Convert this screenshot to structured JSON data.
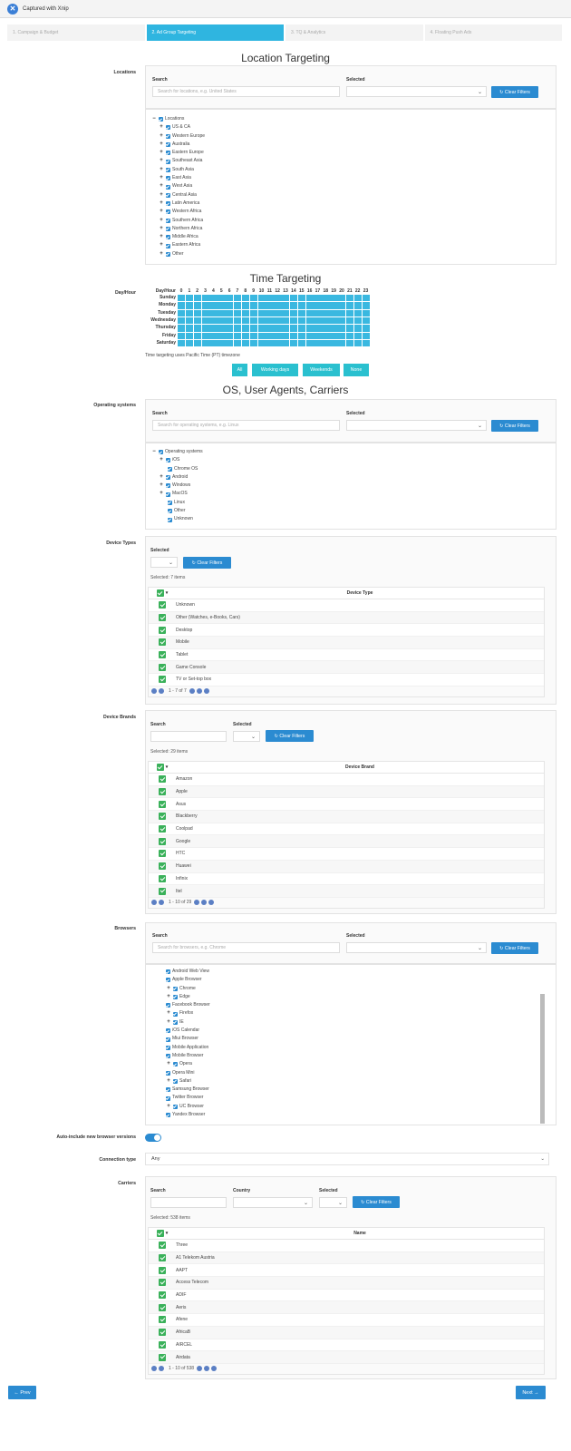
{
  "topbar": {
    "capture_label": "Captured with Xnip"
  },
  "steps": [
    "1. Campaign & Budget",
    "2. Ad Group Targeting",
    "3. TQ & Analytics",
    "4. Floating Push Ads"
  ],
  "location": {
    "heading": "Location Targeting",
    "label": "Locations",
    "search_label": "Search",
    "search_placeholder": "Search for locations, e.g. United States",
    "selected_label": "Selected",
    "clear_label": "Clear Filters",
    "root": "Locations",
    "items": [
      "US & CA",
      "Western Europe",
      "Australia",
      "Eastern Europe",
      "Southeast Asia",
      "South Asia",
      "East Asia",
      "West Asia",
      "Central Asia",
      "Latin America",
      "Western Africa",
      "Southern Africa",
      "Northern Africa",
      "Middle Africa",
      "Eastern Africa",
      "Other"
    ]
  },
  "time": {
    "heading": "Time Targeting",
    "label": "Day/Hour",
    "corner": "Day/Hour",
    "days": [
      "Sunday",
      "Monday",
      "Tuesday",
      "Wednesday",
      "Thursday",
      "Friday",
      "Saturday"
    ],
    "hours": [
      "0",
      "1",
      "2",
      "3",
      "4",
      "5",
      "6",
      "7",
      "8",
      "9",
      "10",
      "11",
      "12",
      "13",
      "14",
      "15",
      "16",
      "17",
      "18",
      "19",
      "20",
      "21",
      "22",
      "23"
    ],
    "note": "Time targeting uses Pacific Time (PT) timezone",
    "buttons": [
      "All",
      "Working days",
      "Weekends",
      "None"
    ]
  },
  "os": {
    "heading": "OS, User Agents, Carriers",
    "label": "Operating systems",
    "search_label": "Search",
    "search_placeholder": "Search for operating systems, e.g. Linux",
    "selected_label": "Selected",
    "clear_label": "Clear Filters",
    "root": "Operating systems",
    "items": [
      {
        "t": "iOS",
        "p": true
      },
      {
        "t": "Chrome OS",
        "p": false
      },
      {
        "t": "Android",
        "p": true
      },
      {
        "t": "Windows",
        "p": true
      },
      {
        "t": "MacOS",
        "p": true
      },
      {
        "t": "Linux",
        "p": false
      },
      {
        "t": "Other",
        "p": false
      },
      {
        "t": "Unknown",
        "p": false
      }
    ]
  },
  "device_types": {
    "label": "Device Types",
    "selected_label": "Selected",
    "clear_label": "Clear Filters",
    "count": "Selected: 7 items",
    "column": "Device Type",
    "rows": [
      "Unknown",
      "Other (Watches, e-Books, Cars)",
      "Desktop",
      "Mobile",
      "Tablet",
      "Game Console",
      "TV or Set-top box"
    ],
    "pager": "1 - 7 of 7"
  },
  "device_brands": {
    "label": "Device Brands",
    "search_label": "Search",
    "selected_label": "Selected",
    "clear_label": "Clear Filters",
    "count": "Selected: 29 items",
    "column": "Device Brand",
    "rows": [
      "Amazon",
      "Apple",
      "Asus",
      "Blackberry",
      "Coolpad",
      "Google",
      "HTC",
      "Huawei",
      "Infinix",
      "Itel"
    ],
    "pager": "1 - 10 of 29"
  },
  "browsers": {
    "label": "Browsers",
    "search_label": "Search",
    "search_placeholder": "Search for browsers, e.g. Chrome",
    "selected_label": "Selected",
    "clear_label": "Clear Filters",
    "items": [
      {
        "t": "Android Web View",
        "p": false
      },
      {
        "t": "Apple Browser",
        "p": false
      },
      {
        "t": "Chrome",
        "p": true
      },
      {
        "t": "Edge",
        "p": true
      },
      {
        "t": "Facebook Browser",
        "p": false
      },
      {
        "t": "Firefox",
        "p": true
      },
      {
        "t": "IE",
        "p": true
      },
      {
        "t": "iOS Calendar",
        "p": false
      },
      {
        "t": "Miui Browser",
        "p": false
      },
      {
        "t": "Mobile Application",
        "p": false
      },
      {
        "t": "Mobile Browser",
        "p": false
      },
      {
        "t": "Opera",
        "p": true
      },
      {
        "t": "Opera Mini",
        "p": false
      },
      {
        "t": "Safari",
        "p": true
      },
      {
        "t": "Samsung Browser",
        "p": false
      },
      {
        "t": "Twitter Browser",
        "p": false
      },
      {
        "t": "UC Browser",
        "p": true
      },
      {
        "t": "Yandex Browser",
        "p": false
      }
    ]
  },
  "auto_include": {
    "label": "Auto-include new browser versions",
    "enabled": true
  },
  "connection": {
    "label": "Connection type",
    "value": "Any"
  },
  "carriers": {
    "label": "Carriers",
    "search_label": "Search",
    "country_label": "Country",
    "selected_label": "Selected",
    "clear_label": "Clear Filters",
    "count": "Selected: 538 items",
    "column": "Name",
    "rows": [
      "Three",
      "A1 Telekom Austria",
      "AAPT",
      "Access Telecom",
      "ADIF",
      "Aeris",
      "Afene",
      "AfricaB",
      "AIRCEL",
      "Airdata"
    ],
    "pager": "1 - 10 of 538"
  },
  "nav": {
    "prev": "← Prev",
    "next": "Next →"
  },
  "colors": {
    "primary": "#2b8bd1",
    "teal": "#2ac0cf",
    "grid": "#3ab8e0",
    "check": "#3ab15a"
  }
}
